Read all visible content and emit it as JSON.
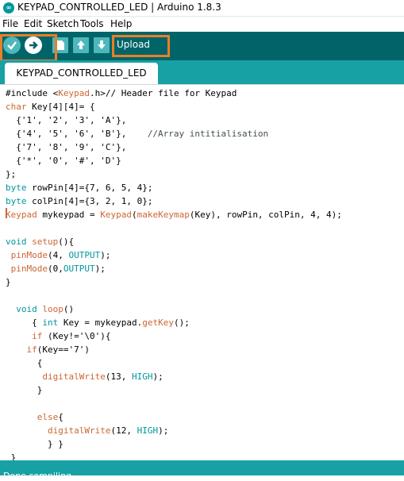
{
  "window": {
    "title": "KEYPAD_CONTROLLED_LED | Arduino 1.8.3",
    "icon": "arduino-logo-icon"
  },
  "menu": [
    "File",
    "Edit",
    "Sketch",
    "Tools",
    "Help"
  ],
  "toolbar": {
    "verify_icon": "checkmark-icon",
    "upload_icon": "arrow-right-icon",
    "new_icon": "new-file-icon",
    "open_icon": "open-arrow-up-icon",
    "save_icon": "save-arrow-down-icon",
    "hover_label": "Upload",
    "highlight_color": "#e97f26"
  },
  "tab": {
    "label": "KEYPAD_CONTROLLED_LED"
  },
  "code": {
    "l1a": "#include <",
    "l1b": "Keypad",
    "l1c": ".h>// Header file for Keypad",
    "l2a": "char",
    "l2b": " Key[4][4]= {",
    "l3": "  {'1', '2', '3', 'A'},",
    "l4a": "  {'4', '5', '6', 'B'},    ",
    "l4b": "//Array intitialisation",
    "l5": "  {'7', '8', '9', 'C'},",
    "l6": "  {'*', '0', '#', 'D'}",
    "l7": "};",
    "l8a": "byte",
    "l8b": " rowPin[4]={7, 6, 5, 4};",
    "l9a": "byte",
    "l9b": " colPin[4]={3, 2, 1, 0};",
    "l10a": "Keypad",
    "l10b": " mykeypad = ",
    "l10c": "Keypad",
    "l10d": "(",
    "l10e": "makeKeymap",
    "l10f": "(Key), rowPin, colPin, 4, 4);",
    "l11a": "void",
    "l11b": " ",
    "l11c": "setup",
    "l11d": "(){",
    "l12a": " ",
    "l12b": "pinMode",
    "l12c": "(4, ",
    "l12d": "OUTPUT",
    "l12e": ");",
    "l13a": " ",
    "l13b": "pinMode",
    "l13c": "(0,",
    "l13d": "OUTPUT",
    "l13e": ");",
    "l14": "}",
    "l15a": "  ",
    "l15b": "void",
    "l15c": " ",
    "l15d": "loop",
    "l15e": "()",
    "l16a": "     { ",
    "l16b": "int",
    "l16c": " Key = mykeypad.",
    "l16d": "getKey",
    "l16e": "();",
    "l17a": "     ",
    "l17b": "if",
    "l17c": " (Key!='\\0'){",
    "l18a": "    ",
    "l18b": "if",
    "l18c": "(Key=='7')",
    "l19": "      {",
    "l20a": "       ",
    "l20b": "digitalWrite",
    "l20c": "(13, ",
    "l20d": "HIGH",
    "l20e": ");",
    "l21": "      }",
    "l22a": "      ",
    "l22b": "else",
    "l22c": "{",
    "l23a": "        ",
    "l23b": "digitalWrite",
    "l23c": "(12, ",
    "l23d": "HIGH",
    "l23e": ");",
    "l24": "        } }",
    "l25": " }"
  },
  "status": {
    "text": "Done compiling."
  }
}
